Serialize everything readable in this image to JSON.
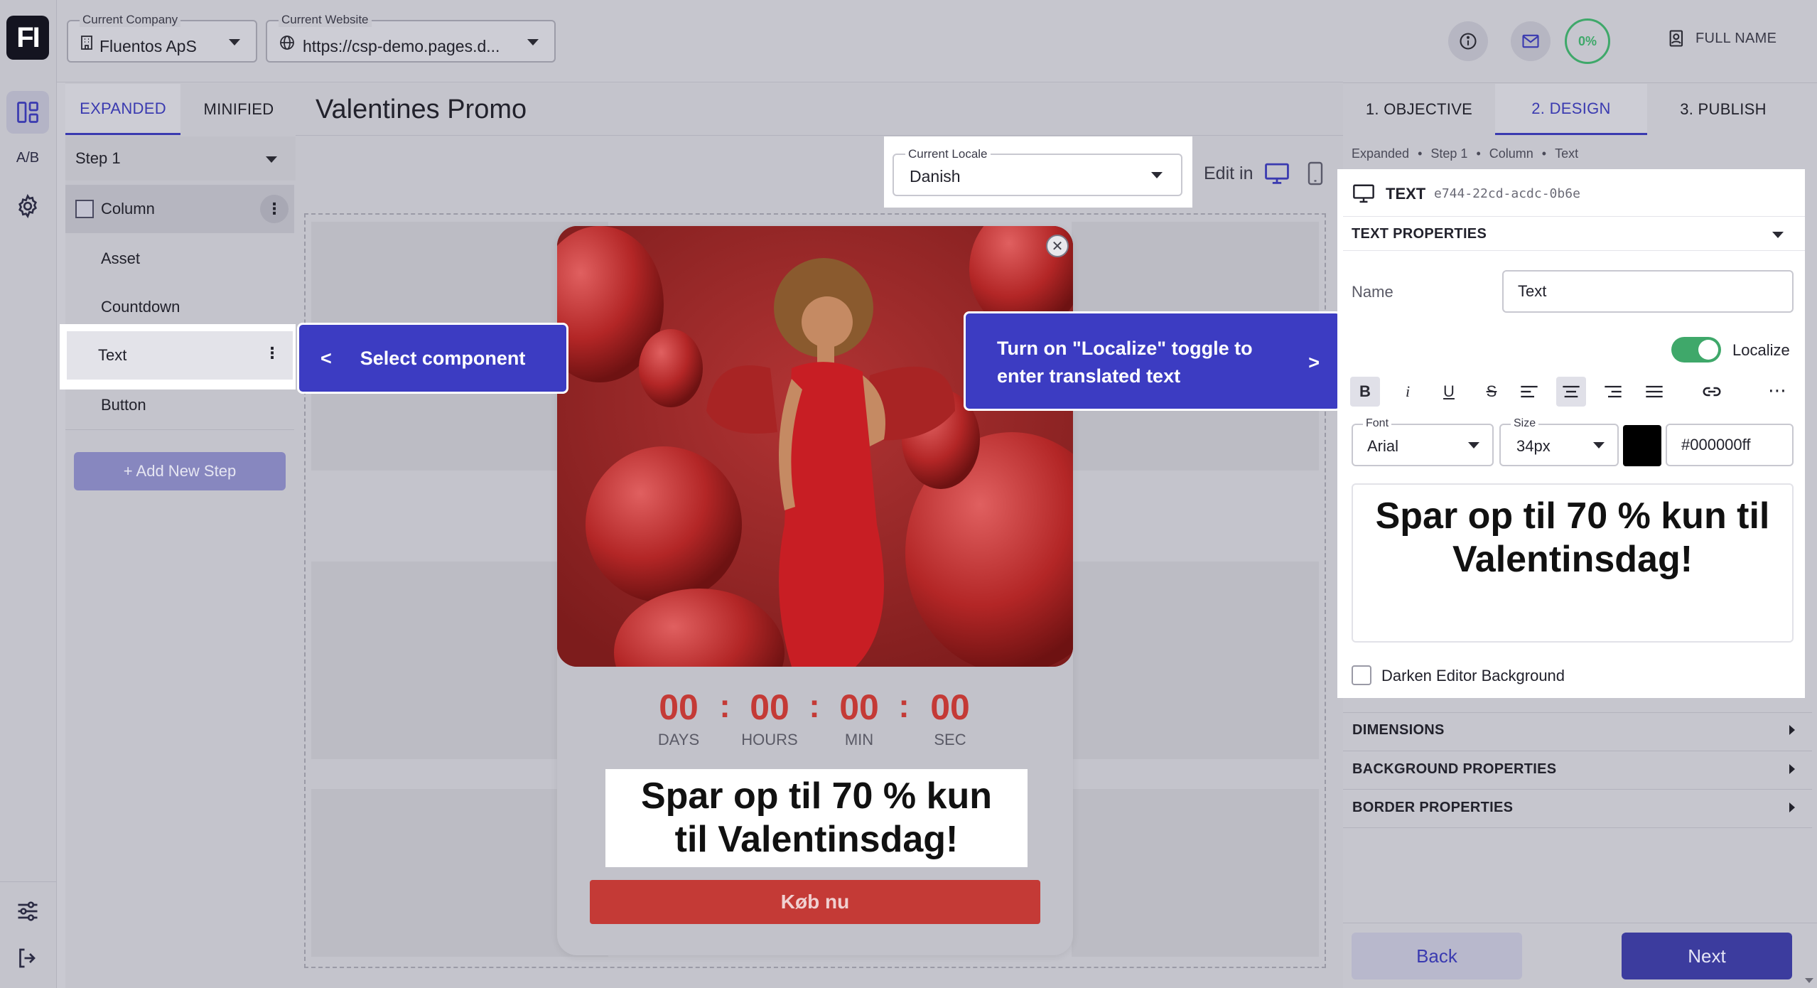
{
  "topbar": {
    "company_label": "Current Company",
    "company_value": "Fluentos ApS",
    "website_label": "Current Website",
    "website_value": "https://csp-demo.pages.d...",
    "progress": "0%",
    "user_name": "FULL NAME"
  },
  "rail": {
    "logo": "FI",
    "ab_label": "A/B"
  },
  "layers": {
    "tabs": [
      "EXPANDED",
      "MINIFIED"
    ],
    "step_value": "Step 1",
    "items": [
      "Column",
      "Asset",
      "Countdown",
      "Text",
      "Button"
    ],
    "add_step": "+ Add New Step"
  },
  "canvas": {
    "title": "Valentines Promo",
    "locale_label": "Current Locale",
    "locale_value": "Danish",
    "edit_in": "Edit in",
    "countdown": [
      {
        "value": "00",
        "unit": "DAYS"
      },
      {
        "value": "00",
        "unit": "HOURS"
      },
      {
        "value": "00",
        "unit": "MIN"
      },
      {
        "value": "00",
        "unit": "SEC"
      }
    ],
    "separator": ":",
    "promo_text": "Spar op til 70 % kun til Valentinsdag!",
    "cta": "Køb nu"
  },
  "callouts": {
    "left_prefix": "<",
    "left_text": "Select component",
    "right_text": "Turn on \"Localize\" toggle to enter translated text",
    "right_suffix": ">"
  },
  "right": {
    "tabs": [
      "1. OBJECTIVE",
      "2. DESIGN",
      "3. PUBLISH"
    ],
    "breadcrumb": [
      "Expanded",
      "Step 1",
      "Column",
      "Text"
    ],
    "breadcrumb_sep": "•",
    "element_type": "TEXT",
    "element_id": "e744-22cd-acdc-0b6e",
    "section_text": "TEXT PROPERTIES",
    "name_label": "Name",
    "name_value": "Text",
    "localize_label": "Localize",
    "format_buttons": [
      "B",
      "i",
      "U",
      "S"
    ],
    "font_label": "Font",
    "font_value": "Arial",
    "size_label": "Size",
    "size_value": "34px",
    "color_value": "#000000ff",
    "editor_text": "Spar op til 70 % kun til Valentinsdag!",
    "darken_label": "Darken Editor Background",
    "sections": [
      "DIMENSIONS",
      "BACKGROUND PROPERTIES",
      "BORDER PROPERTIES"
    ],
    "back": "Back",
    "next": "Next"
  },
  "colors": {
    "accent": "#3c3cc2",
    "cta": "#cc3b36",
    "countdown": "#cc3b36",
    "toggle": "#3fa86a"
  }
}
